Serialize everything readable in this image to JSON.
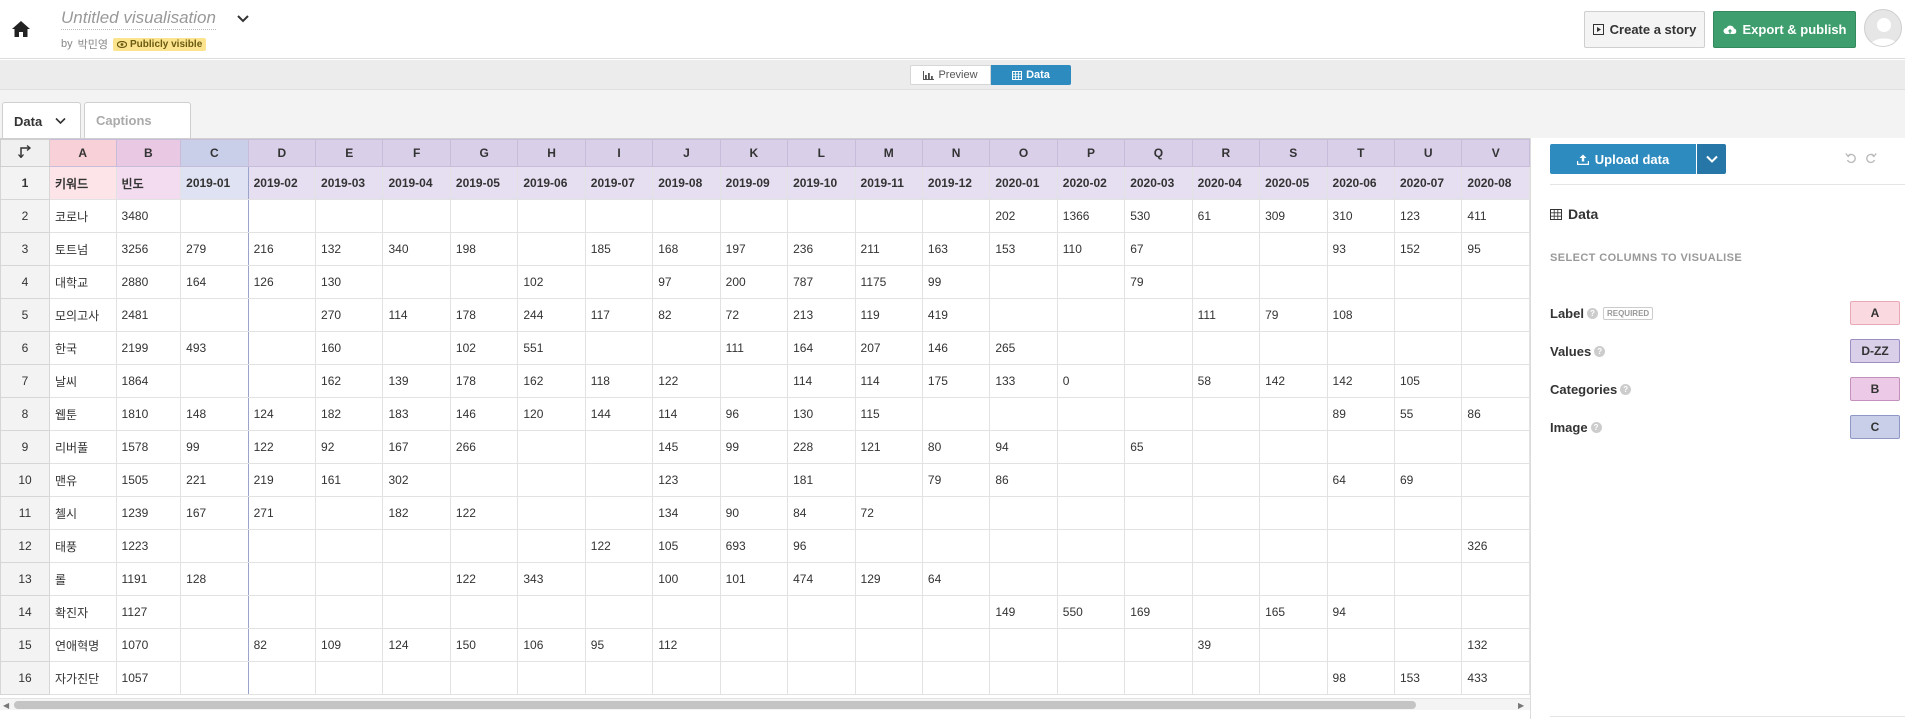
{
  "header": {
    "title": "Untitled visualisation",
    "by_prefix": "by",
    "author": "박민영",
    "visibility": "Publicly visible",
    "create_story": "Create a story",
    "export_publish": "Export & publish"
  },
  "toggle": {
    "preview": "Preview",
    "data": "Data"
  },
  "tabs": {
    "data": "Data",
    "captions": "Captions"
  },
  "sheet": {
    "columns": [
      "A",
      "B",
      "C",
      "D",
      "E",
      "F",
      "G",
      "H",
      "I",
      "J",
      "K",
      "L",
      "M",
      "N",
      "O",
      "P",
      "Q",
      "R",
      "S",
      "T",
      "U",
      "V"
    ],
    "header_row": [
      "키워드",
      "빈도",
      "2019-01",
      "2019-02",
      "2019-03",
      "2019-04",
      "2019-05",
      "2019-06",
      "2019-07",
      "2019-08",
      "2019-09",
      "2019-10",
      "2019-11",
      "2019-12",
      "2020-01",
      "2020-02",
      "2020-03",
      "2020-04",
      "2020-05",
      "2020-06",
      "2020-07",
      "2020-08"
    ],
    "rows": [
      [
        "코로나",
        "3480",
        "",
        "",
        "",
        "",
        "",
        "",
        "",
        "",
        "",
        "",
        "",
        "",
        "202",
        "1366",
        "530",
        "61",
        "309",
        "310",
        "123",
        "411"
      ],
      [
        "토트넘",
        "3256",
        "279",
        "216",
        "132",
        "340",
        "198",
        "",
        "185",
        "168",
        "197",
        "236",
        "211",
        "163",
        "153",
        "110",
        "67",
        "",
        "",
        "93",
        "152",
        "95"
      ],
      [
        "대학교",
        "2880",
        "164",
        "126",
        "130",
        "",
        "",
        "102",
        "",
        "97",
        "200",
        "787",
        "1175",
        "99",
        "",
        "",
        "79",
        "",
        "",
        "",
        "",
        ""
      ],
      [
        "모의고사",
        "2481",
        "",
        "",
        "270",
        "114",
        "178",
        "244",
        "117",
        "82",
        "72",
        "213",
        "119",
        "419",
        "",
        "",
        "",
        "111",
        "79",
        "108",
        "",
        ""
      ],
      [
        "한국",
        "2199",
        "493",
        "",
        "160",
        "",
        "102",
        "551",
        "",
        "",
        "111",
        "164",
        "207",
        "146",
        "265",
        "",
        "",
        "",
        "",
        "",
        "",
        ""
      ],
      [
        "날씨",
        "1864",
        "",
        "",
        "162",
        "139",
        "178",
        "162",
        "118",
        "122",
        "",
        "114",
        "114",
        "175",
        "133",
        "0",
        "",
        "58",
        "142",
        "142",
        "105",
        ""
      ],
      [
        "웹툰",
        "1810",
        "148",
        "124",
        "182",
        "183",
        "146",
        "120",
        "144",
        "114",
        "96",
        "130",
        "115",
        "",
        "",
        "",
        "",
        "",
        "",
        "89",
        "55",
        "86"
      ],
      [
        "리버풀",
        "1578",
        "99",
        "122",
        "92",
        "167",
        "266",
        "",
        "",
        "145",
        "99",
        "228",
        "121",
        "80",
        "94",
        "",
        "65",
        "",
        "",
        "",
        "",
        ""
      ],
      [
        "맨유",
        "1505",
        "221",
        "219",
        "161",
        "302",
        "",
        "",
        "",
        "123",
        "",
        "181",
        "",
        "79",
        "86",
        "",
        "",
        "",
        "",
        "64",
        "69",
        ""
      ],
      [
        "첼시",
        "1239",
        "167",
        "271",
        "",
        "182",
        "122",
        "",
        "",
        "134",
        "90",
        "84",
        "72",
        "",
        "",
        "",
        "",
        "",
        "",
        "",
        "",
        ""
      ],
      [
        "태풍",
        "1223",
        "",
        "",
        "",
        "",
        "",
        "",
        "122",
        "105",
        "693",
        "96",
        "",
        "",
        "",
        "",
        "",
        "",
        "",
        "",
        "",
        "326"
      ],
      [
        "롤",
        "1191",
        "128",
        "",
        "",
        "",
        "122",
        "343",
        "",
        "100",
        "101",
        "474",
        "129",
        "64",
        "",
        "",
        "",
        "",
        "",
        "",
        "",
        ""
      ],
      [
        "확진자",
        "1127",
        "",
        "",
        "",
        "",
        "",
        "",
        "",
        "",
        "",
        "",
        "",
        "",
        "149",
        "550",
        "169",
        "",
        "165",
        "94",
        "",
        ""
      ],
      [
        "연애혁명",
        "1070",
        "",
        "82",
        "109",
        "124",
        "150",
        "106",
        "95",
        "112",
        "",
        "",
        "",
        "",
        "",
        "",
        "",
        "39",
        "",
        "",
        "",
        "132"
      ],
      [
        "자가진단",
        "1057",
        "",
        "",
        "",
        "",
        "",
        "",
        "",
        "",
        "",
        "",
        "",
        "",
        "",
        "",
        "",
        "",
        "",
        "98",
        "153",
        "433"
      ]
    ]
  },
  "panel": {
    "upload": "Upload data",
    "heading": "Data",
    "select_label": "SELECT COLUMNS TO VISUALISE",
    "bindings": [
      {
        "name": "Label",
        "required": "REQUIRED",
        "value": "A",
        "color": "#fbd9e0"
      },
      {
        "name": "Values",
        "required": "",
        "value": "D-ZZ",
        "color": "#d9cfe9"
      },
      {
        "name": "Categories",
        "required": "",
        "value": "B",
        "color": "#ecc9e6"
      },
      {
        "name": "Image",
        "required": "",
        "value": "C",
        "color": "#c9cfe9"
      }
    ]
  },
  "colors": {
    "accent_blue": "#2e8bc0",
    "export_green": "#3e9e6e",
    "badge_yellow": "#fbe48d"
  }
}
